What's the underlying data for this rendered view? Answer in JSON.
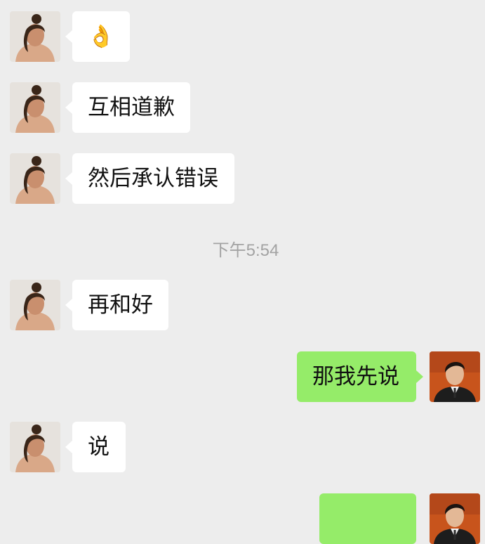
{
  "chat": {
    "messages": [
      {
        "side": "left",
        "text": "👌"
      },
      {
        "side": "left",
        "text": "互相道歉"
      },
      {
        "side": "left",
        "text": "然后承认错误"
      },
      {
        "side": "left",
        "text": "再和好"
      },
      {
        "side": "right",
        "text": "那我先说"
      },
      {
        "side": "left",
        "text": "说"
      },
      {
        "side": "right",
        "text": ""
      }
    ],
    "timestamp": "下午5:54"
  },
  "colors": {
    "background": "#ededed",
    "bubble_left": "#ffffff",
    "bubble_right": "#95ec69",
    "timestamp_text": "#a3a3a3"
  }
}
